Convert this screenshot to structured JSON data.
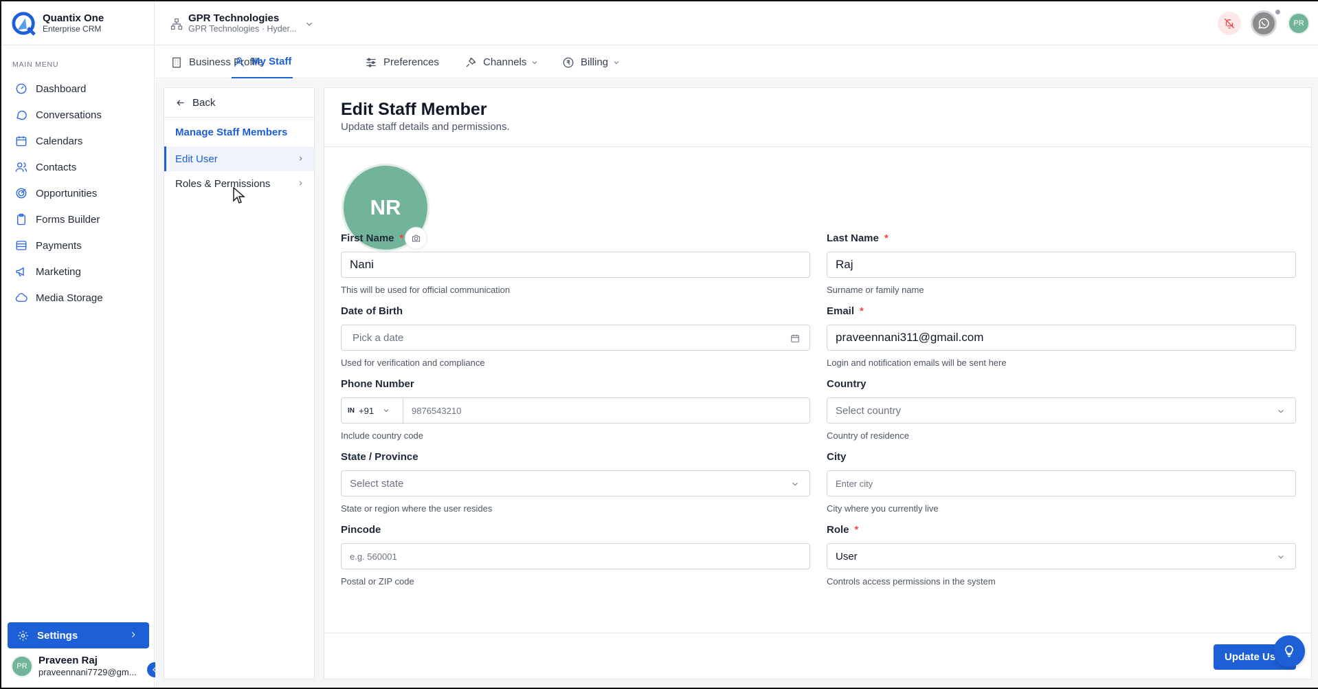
{
  "brand": {
    "name": "Quantix One",
    "subtitle": "Enterprise CRM"
  },
  "sidebar": {
    "menu_heading": "MAIN MENU",
    "items": [
      {
        "label": "Dashboard",
        "icon": "gauge-icon"
      },
      {
        "label": "Conversations",
        "icon": "chat-bubble-icon"
      },
      {
        "label": "Calendars",
        "icon": "calendar-icon"
      },
      {
        "label": "Contacts",
        "icon": "users-icon"
      },
      {
        "label": "Opportunities",
        "icon": "target-icon"
      },
      {
        "label": "Forms Builder",
        "icon": "clipboard-icon"
      },
      {
        "label": "Payments",
        "icon": "credit-card-icon"
      },
      {
        "label": "Marketing",
        "icon": "megaphone-icon"
      },
      {
        "label": "Media Storage",
        "icon": "cloud-icon"
      }
    ],
    "settings_label": "Settings",
    "user": {
      "initials": "PR",
      "name": "Praveen Raj",
      "email": "praveennani7729@gm..."
    }
  },
  "topbar": {
    "org_name": "GPR Technologies",
    "org_sub": "GPR Technologies · Hyder...",
    "avatar_initials": "PR"
  },
  "tabs": [
    {
      "label": "Business Profile",
      "icon": "building-icon"
    },
    {
      "label": "My Staff",
      "icon": "user-icon",
      "active": true
    },
    {
      "label": "Preferences",
      "icon": "sliders-icon"
    },
    {
      "label": "Channels",
      "icon": "plug-icon",
      "dropdown": true
    },
    {
      "label": "Billing",
      "icon": "rupee-icon",
      "dropdown": true
    }
  ],
  "left_panel": {
    "back_label": "Back",
    "heading": "Manage Staff Members",
    "items": [
      {
        "label": "Edit User",
        "active": true
      },
      {
        "label": "Roles & Permissions",
        "active": false
      }
    ]
  },
  "form": {
    "title": "Edit Staff Member",
    "subtitle": "Update staff details and permissions.",
    "avatar_initials": "NR",
    "first_name": {
      "label": "First Name",
      "value": "Nani",
      "help": "This will be used for official communication"
    },
    "last_name": {
      "label": "Last Name",
      "value": "Raj",
      "help": "Surname or family name"
    },
    "dob": {
      "label": "Date of Birth",
      "placeholder": "Pick a date",
      "help": "Used for verification and compliance"
    },
    "email": {
      "label": "Email",
      "value": "praveennani311@gmail.com",
      "help": "Login and notification emails will be sent here"
    },
    "phone": {
      "label": "Phone Number",
      "flag": "IN",
      "code": "+91",
      "placeholder": "9876543210",
      "help": "Include country code"
    },
    "country": {
      "label": "Country",
      "placeholder": "Select country",
      "help": "Country of residence"
    },
    "state": {
      "label": "State / Province",
      "placeholder": "Select state",
      "help": "State or region where the user resides"
    },
    "city": {
      "label": "City",
      "placeholder": "Enter city",
      "help": "City where you currently live"
    },
    "pincode": {
      "label": "Pincode",
      "placeholder": "e.g. 560001",
      "help": "Postal or ZIP code"
    },
    "role": {
      "label": "Role",
      "value": "User",
      "help": "Controls access permissions in the system"
    },
    "required_mark": "*",
    "submit_label": "Update User"
  },
  "colors": {
    "accent": "#1d5fd6",
    "avatar": "#72b49a",
    "required": "#ef4444"
  }
}
